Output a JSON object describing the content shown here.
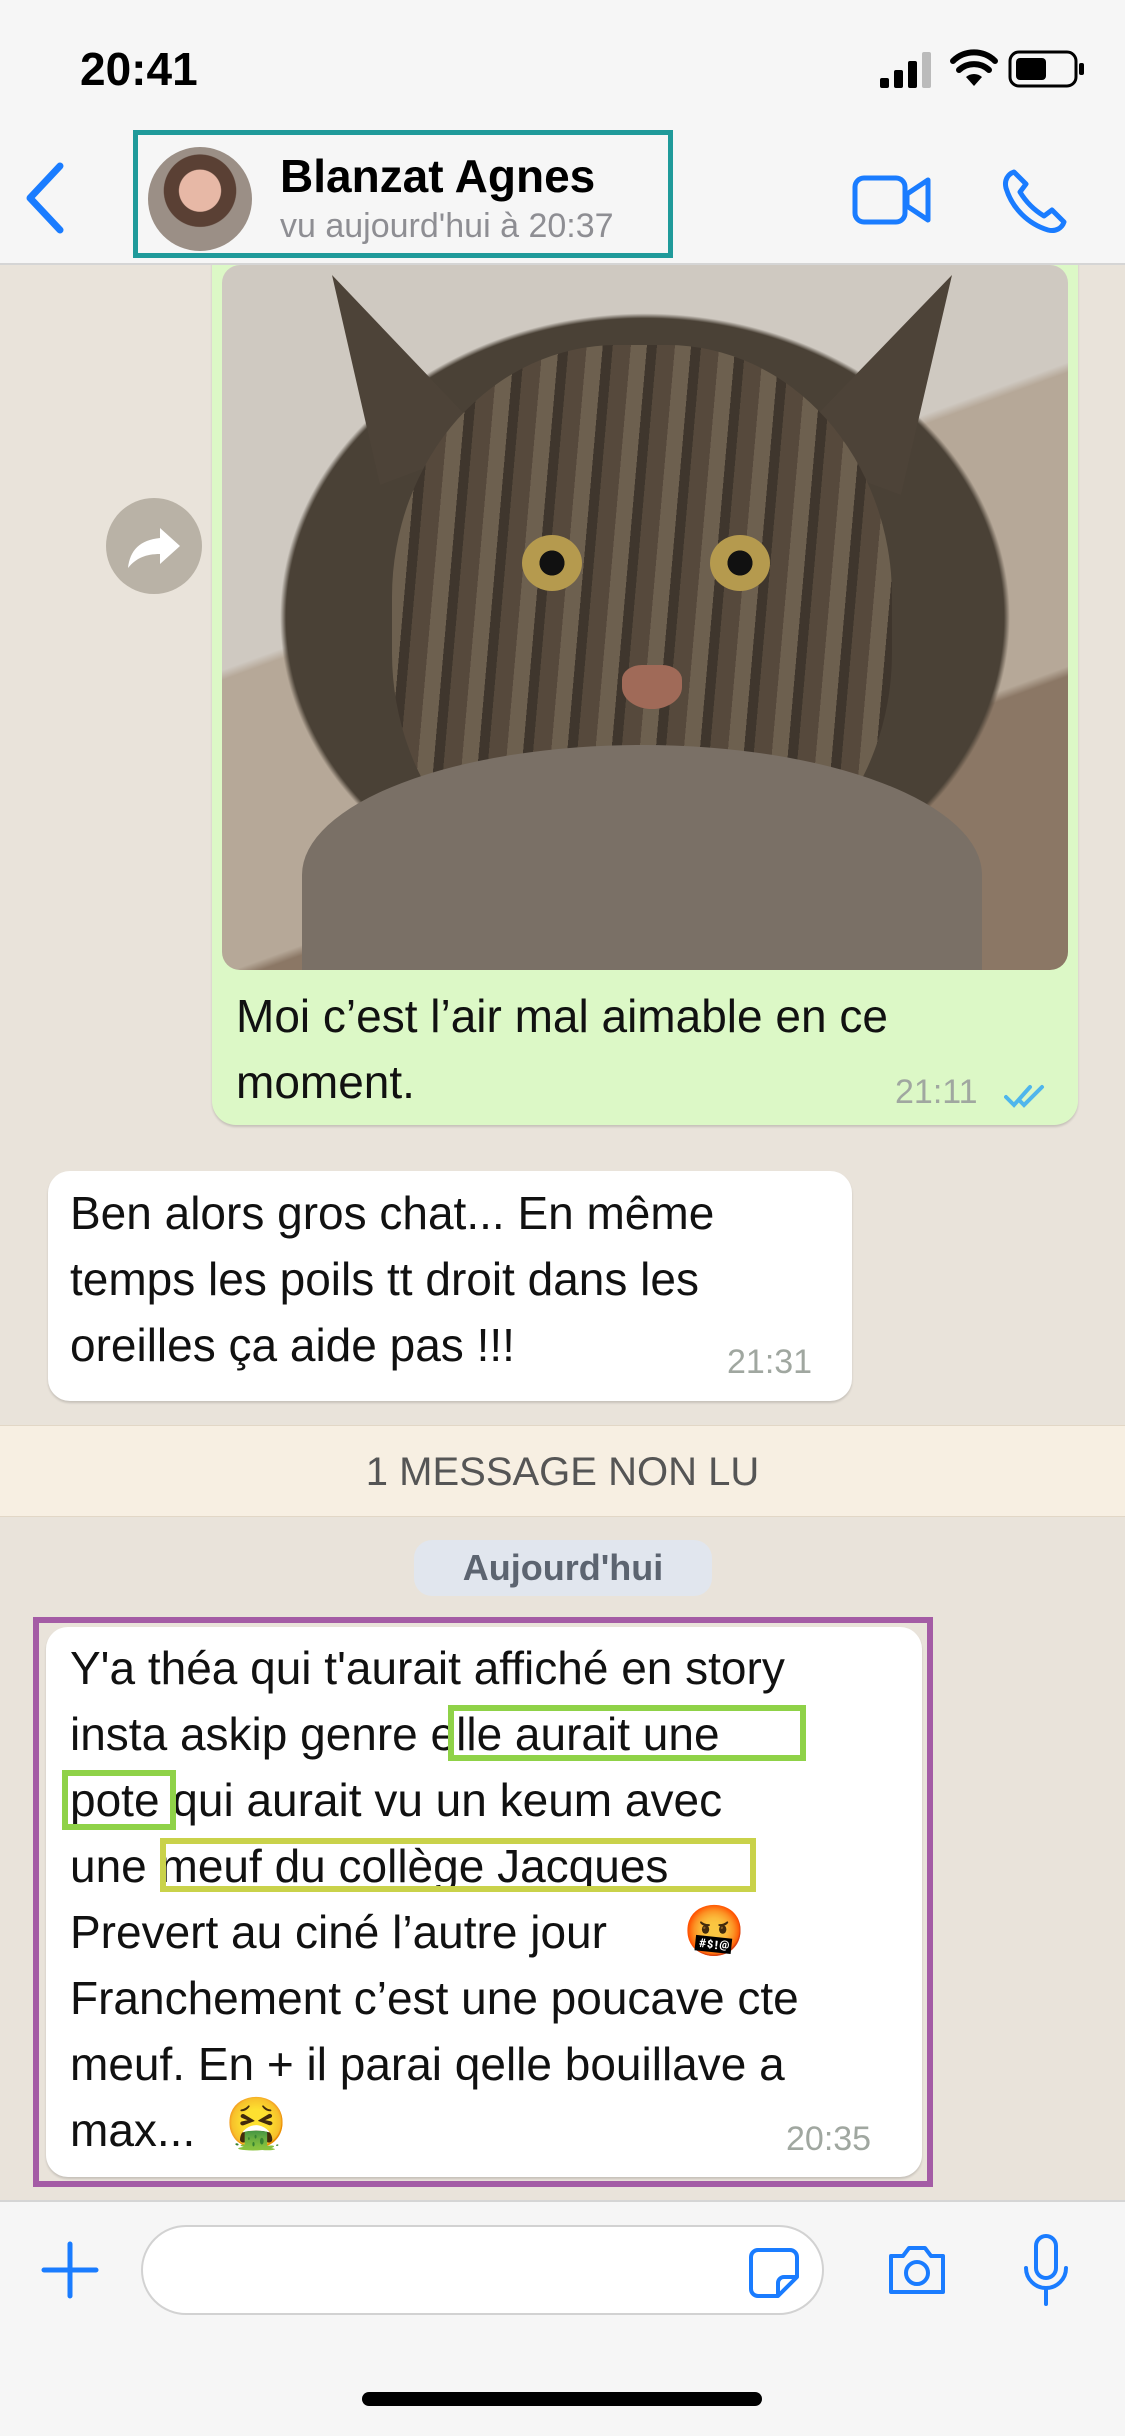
{
  "status_bar": {
    "time": "20:41"
  },
  "header": {
    "contact_name": "Blanzat Agnes",
    "last_seen": "vu aujourd'hui à 20:37"
  },
  "messages": [
    {
      "direction": "outgoing",
      "text_lines": [
        "Moi c’est l’air mal aimable en ce",
        "moment."
      ],
      "time": "21:11",
      "status": "read"
    },
    {
      "direction": "incoming",
      "text_lines": [
        "Ben alors gros chat... En même",
        "temps les poils tt droit dans les",
        "oreilles ça aide pas !!!"
      ],
      "time": "21:31"
    },
    {
      "direction": "incoming",
      "text_lines": [
        "Y'a théa qui t'aurait affiché en story",
        "insta askip genre elle aurait une",
        "pote qui aurait vu  un keum avec",
        "une meuf du collège Jacques",
        "Prevert au ciné l’autre jour",
        "Franchement c’est une poucave cte",
        "meuf. En + il parai qelle bouillave a",
        "max..."
      ],
      "emojis": [
        "🤬",
        "🤮"
      ],
      "time": "20:35"
    }
  ],
  "unread_banner": "1 MESSAGE NON LU",
  "date_chip": "Aujourd'hui",
  "colors": {
    "accent": "#1a7cff",
    "outgoing_bubble": "#dcf8c6",
    "incoming_bubble": "#ffffff",
    "teal_box": "#1f9a9a",
    "purple_box": "#a45ca5",
    "green_highlight": "#8fd248",
    "yellow_highlight": "#c9d24a"
  },
  "icons": [
    "back-chevron-icon",
    "video-call-icon",
    "phone-call-icon",
    "forward-icon",
    "read-receipt-icon",
    "plus-icon",
    "sticker-icon",
    "camera-icon",
    "microphone-icon"
  ]
}
